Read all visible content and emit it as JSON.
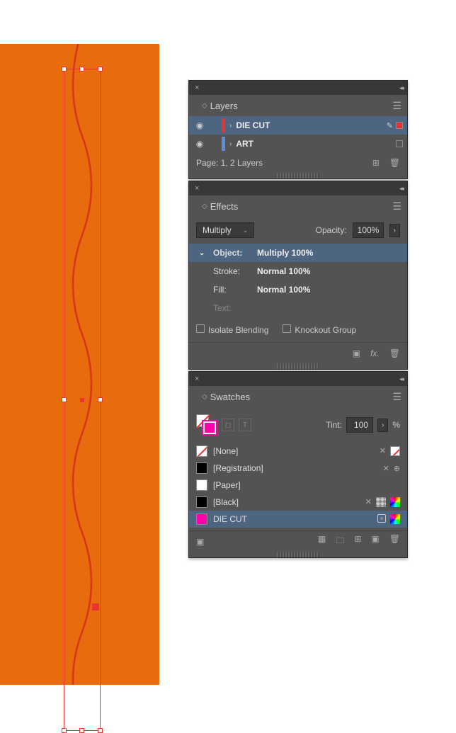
{
  "layers_panel": {
    "title": "Layers",
    "items": [
      {
        "name": "DIE CUT",
        "color": "#e33333",
        "selected": true
      },
      {
        "name": "ART",
        "color": "#5a8fd6",
        "selected": false
      }
    ],
    "footer": "Page: 1, 2 Layers"
  },
  "effects_panel": {
    "title": "Effects",
    "blend_mode": "Multiply",
    "opacity_label": "Opacity:",
    "opacity_value": "100%",
    "rows": [
      {
        "label": "Object:",
        "value": "Multiply 100%",
        "header": true
      },
      {
        "label": "Stroke:",
        "value": "Normal 100%"
      },
      {
        "label": "Fill:",
        "value": "Normal 100%"
      },
      {
        "label": "Text:",
        "value": "",
        "dim": true
      }
    ],
    "isolate_label": "Isolate Blending",
    "knockout_label": "Knockout Group"
  },
  "swatches_panel": {
    "title": "Swatches",
    "tint_label": "Tint:",
    "tint_value": "100",
    "tint_suffix": "%",
    "items": [
      {
        "name": "[None]",
        "class": "sw-none"
      },
      {
        "name": "[Registration]",
        "class": "sw-reg"
      },
      {
        "name": "[Paper]",
        "class": "sw-paper"
      },
      {
        "name": "[Black]",
        "class": "sw-black"
      },
      {
        "name": "DIE CUT",
        "class": "sw-diecut",
        "selected": true
      }
    ]
  }
}
